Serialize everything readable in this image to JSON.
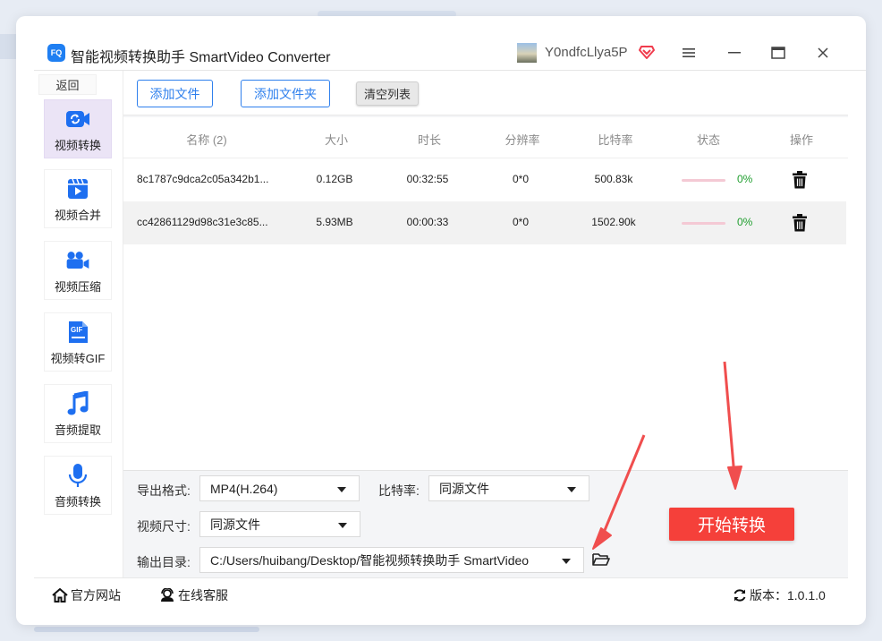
{
  "window": {
    "title": "智能视频转换助手 SmartVideo Converter",
    "logo_text": "FQ",
    "user_name": "Y0ndfcLlya5P"
  },
  "sidebar": {
    "back_label": "返回",
    "items": [
      {
        "label": "视频转换",
        "icon": "video-convert-icon",
        "active": true
      },
      {
        "label": "视频合并",
        "icon": "video-merge-icon",
        "active": false
      },
      {
        "label": "视频压缩",
        "icon": "video-compress-icon",
        "active": false
      },
      {
        "label": "视频转GIF",
        "icon": "gif-icon",
        "active": false
      },
      {
        "label": "音频提取",
        "icon": "music-note-icon",
        "active": false
      },
      {
        "label": "音频转换",
        "icon": "microphone-icon",
        "active": false
      }
    ],
    "gif_badge": "GIF"
  },
  "toolbar": {
    "add_file": "添加文件",
    "add_folder": "添加文件夹",
    "clear_list": "清空列表"
  },
  "table": {
    "headers": [
      "名称 (2)",
      "大小",
      "时长",
      "分辨率",
      "比特率",
      "状态",
      "操作"
    ],
    "rows": [
      {
        "name": "8c1787c9dca2c05a342b1...",
        "size": "0.12GB",
        "duration": "00:32:55",
        "resolution": "0*0",
        "bitrate": "500.83k",
        "progress": "0%"
      },
      {
        "name": "cc42861129d98c31e3c85...",
        "size": "5.93MB",
        "duration": "00:00:33",
        "resolution": "0*0",
        "bitrate": "1502.90k",
        "progress": "0%"
      }
    ]
  },
  "settings": {
    "format_label": "导出格式:",
    "format_value": "MP4(H.264)",
    "bitrate_label": "比特率:",
    "bitrate_value": "同源文件",
    "size_label": "视频尺寸:",
    "size_value": "同源文件",
    "output_label": "输出目录:",
    "output_value": "C:/Users/huibang/Desktop/智能视频转换助手 SmartVideo",
    "start_button": "开始转换"
  },
  "footer": {
    "website": "官方网站",
    "support": "在线客服",
    "version": "版本：1.0.1.0"
  },
  "colors": {
    "accent": "#2f80ed",
    "start_button": "#f5403a",
    "progress_text": "#1f9e2e",
    "active_nav": "#ebe4f6",
    "annotation_arrow": "#f04e4e"
  }
}
